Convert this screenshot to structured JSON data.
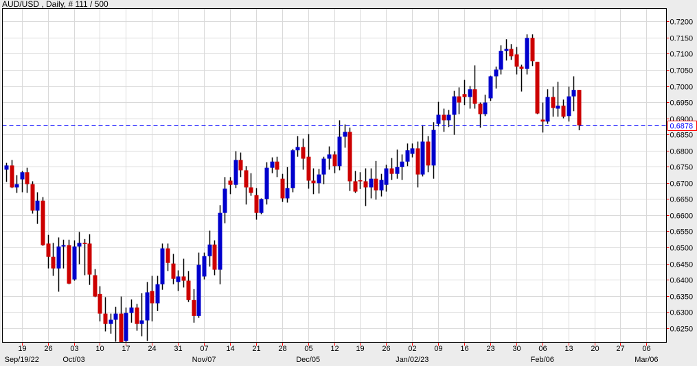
{
  "header": {
    "title": "AUD/USD , Daily, # 111 / 500"
  },
  "chart_data": {
    "type": "candlestick",
    "symbol": "AUD/USD",
    "timeframe": "Daily",
    "bars_shown": 111,
    "bars_total": 500,
    "start_date": "2022-09-14",
    "ylim": [
      0.6206,
      0.724
    ],
    "y_ticks": [
      0.625,
      0.63,
      0.635,
      0.64,
      0.645,
      0.65,
      0.655,
      0.66,
      0.665,
      0.67,
      0.675,
      0.68,
      0.685,
      0.69,
      0.695,
      0.7,
      0.705,
      0.71,
      0.715,
      0.72
    ],
    "current_price": 0.6878,
    "current_price_label": "0.6878",
    "colors": {
      "up": "#0000cc",
      "down": "#cc0000",
      "wick": "#000000",
      "price_line": "#0000ff",
      "grid": "#d9d9d9",
      "tick": "#ff0000"
    },
    "week_ticks": [
      {
        "label": "19",
        "date": "2022-09-19"
      },
      {
        "label": "26",
        "date": "2022-09-26"
      },
      {
        "label": "03",
        "date": "2022-10-03"
      },
      {
        "label": "10",
        "date": "2022-10-10"
      },
      {
        "label": "17",
        "date": "2022-10-17"
      },
      {
        "label": "24",
        "date": "2022-10-24"
      },
      {
        "label": "31",
        "date": "2022-10-31"
      },
      {
        "label": "07",
        "date": "2022-11-07"
      },
      {
        "label": "14",
        "date": "2022-11-14"
      },
      {
        "label": "21",
        "date": "2022-11-21"
      },
      {
        "label": "28",
        "date": "2022-11-28"
      },
      {
        "label": "05",
        "date": "2022-12-05"
      },
      {
        "label": "12",
        "date": "2022-12-12"
      },
      {
        "label": "19",
        "date": "2022-12-19"
      },
      {
        "label": "26",
        "date": "2022-12-26"
      },
      {
        "label": "02",
        "date": "2023-01-02"
      },
      {
        "label": "09",
        "date": "2023-01-09"
      },
      {
        "label": "16",
        "date": "2023-01-16"
      },
      {
        "label": "23",
        "date": "2023-01-23"
      },
      {
        "label": "30",
        "date": "2023-01-30"
      },
      {
        "label": "06",
        "date": "2023-02-06"
      },
      {
        "label": "13",
        "date": "2023-02-13"
      },
      {
        "label": "20",
        "date": "2023-02-20"
      },
      {
        "label": "27",
        "date": "2023-02-27"
      },
      {
        "label": "06",
        "date": "2023-03-06"
      }
    ],
    "month_labels": [
      {
        "label": "Sep/19/22",
        "date": "2022-09-19"
      },
      {
        "label": "Oct/03",
        "date": "2022-10-03"
      },
      {
        "label": "Nov/07",
        "date": "2022-11-07"
      },
      {
        "label": "Dec/05",
        "date": "2022-12-05"
      },
      {
        "label": "Jan/02/23",
        "date": "2023-01-02"
      },
      {
        "label": "Feb/06",
        "date": "2023-02-06"
      },
      {
        "label": "Mar/06",
        "date": "2023-03-06"
      }
    ],
    "ohlc_fields": [
      "open",
      "high",
      "low",
      "close"
    ],
    "candles": [
      [
        0.6741,
        0.6762,
        0.6703,
        0.6754
      ],
      [
        0.6754,
        0.6771,
        0.6684,
        0.6686
      ],
      [
        0.6686,
        0.6724,
        0.6669,
        0.6696
      ],
      [
        0.6711,
        0.6737,
        0.6671,
        0.6733
      ],
      [
        0.6733,
        0.6747,
        0.6669,
        0.6696
      ],
      [
        0.6696,
        0.6705,
        0.6605,
        0.6614
      ],
      [
        0.6614,
        0.6671,
        0.6573,
        0.6645
      ],
      [
        0.6645,
        0.6656,
        0.6505,
        0.6507
      ],
      [
        0.6512,
        0.6539,
        0.6435,
        0.6471
      ],
      [
        0.6471,
        0.6514,
        0.6412,
        0.6435
      ],
      [
        0.6435,
        0.6531,
        0.6363,
        0.6503
      ],
      [
        0.6503,
        0.6524,
        0.6435,
        0.6507
      ],
      [
        0.6507,
        0.6524,
        0.6386,
        0.6388
      ],
      [
        0.6401,
        0.6522,
        0.6397,
        0.6503
      ],
      [
        0.6503,
        0.6548,
        0.6448,
        0.6514
      ],
      [
        0.6514,
        0.6526,
        0.6414,
        0.6513
      ],
      [
        0.6512,
        0.6541,
        0.6384,
        0.6416
      ],
      [
        0.6414,
        0.6433,
        0.6346,
        0.6348
      ],
      [
        0.6356,
        0.638,
        0.6271,
        0.6295
      ],
      [
        0.6295,
        0.6346,
        0.624,
        0.6263
      ],
      [
        0.6263,
        0.6295,
        0.6233,
        0.6276
      ],
      [
        0.6276,
        0.6316,
        0.6208,
        0.6295
      ],
      [
        0.6295,
        0.6348,
        0.62,
        0.6205
      ],
      [
        0.621,
        0.6314,
        0.62,
        0.6297
      ],
      [
        0.6297,
        0.6339,
        0.6267,
        0.6314
      ],
      [
        0.6314,
        0.6325,
        0.6242,
        0.6263
      ],
      [
        0.6263,
        0.6358,
        0.6225,
        0.6274
      ],
      [
        0.6274,
        0.6393,
        0.621,
        0.6361
      ],
      [
        0.6365,
        0.6412,
        0.6271,
        0.6327
      ],
      [
        0.6327,
        0.6412,
        0.6303,
        0.6386
      ],
      [
        0.6386,
        0.6512,
        0.6369,
        0.6497
      ],
      [
        0.6497,
        0.6512,
        0.6427,
        0.6452
      ],
      [
        0.645,
        0.648,
        0.6386,
        0.6403
      ],
      [
        0.6393,
        0.6429,
        0.6365,
        0.641
      ],
      [
        0.641,
        0.6465,
        0.6376,
        0.6397
      ],
      [
        0.6397,
        0.6427,
        0.6331,
        0.6337
      ],
      [
        0.6337,
        0.6371,
        0.6267,
        0.6288
      ],
      [
        0.6288,
        0.6484,
        0.6282,
        0.6446
      ],
      [
        0.641,
        0.6484,
        0.6401,
        0.6473
      ],
      [
        0.6473,
        0.6552,
        0.6441,
        0.6509
      ],
      [
        0.6509,
        0.6522,
        0.6414,
        0.6431
      ],
      [
        0.6431,
        0.6631,
        0.6386,
        0.6607
      ],
      [
        0.6607,
        0.6718,
        0.6575,
        0.6682
      ],
      [
        0.6707,
        0.6718,
        0.6665,
        0.6694
      ],
      [
        0.6694,
        0.6798,
        0.6684,
        0.6771
      ],
      [
        0.6771,
        0.6794,
        0.6718,
        0.6739
      ],
      [
        0.6739,
        0.6752,
        0.6633,
        0.6686
      ],
      [
        0.6686,
        0.673,
        0.666,
        0.6669
      ],
      [
        0.6662,
        0.6684,
        0.6586,
        0.6607
      ],
      [
        0.6607,
        0.6652,
        0.6603,
        0.665
      ],
      [
        0.665,
        0.6764,
        0.6633,
        0.6747
      ],
      [
        0.6747,
        0.6779,
        0.673,
        0.6766
      ],
      [
        0.6766,
        0.6781,
        0.6718,
        0.6741
      ],
      [
        0.6713,
        0.6728,
        0.6641,
        0.6652
      ],
      [
        0.6652,
        0.6749,
        0.6639,
        0.6684
      ],
      [
        0.6684,
        0.6805,
        0.6671,
        0.6801
      ],
      [
        0.6801,
        0.6845,
        0.6781,
        0.6811
      ],
      [
        0.6811,
        0.6837,
        0.6741,
        0.6775
      ],
      [
        0.6781,
        0.6851,
        0.6682,
        0.6707
      ],
      [
        0.6707,
        0.6745,
        0.6665,
        0.6699
      ],
      [
        0.6699,
        0.6743,
        0.6667,
        0.6726
      ],
      [
        0.6726,
        0.6781,
        0.6696,
        0.6775
      ],
      [
        0.6775,
        0.6813,
        0.6741,
        0.6788
      ],
      [
        0.6788,
        0.6798,
        0.673,
        0.6752
      ],
      [
        0.6752,
        0.6894,
        0.6739,
        0.6843
      ],
      [
        0.6843,
        0.6881,
        0.6809,
        0.6858
      ],
      [
        0.6858,
        0.6871,
        0.6675,
        0.6705
      ],
      [
        0.6705,
        0.6737,
        0.6669,
        0.6673
      ],
      [
        0.6708,
        0.6733,
        0.6681,
        0.6707
      ],
      [
        0.6705,
        0.6745,
        0.6628,
        0.6686
      ],
      [
        0.6686,
        0.6745,
        0.6652,
        0.6713
      ],
      [
        0.6713,
        0.6768,
        0.6648,
        0.6677
      ],
      [
        0.6677,
        0.6728,
        0.6658,
        0.6709
      ],
      [
        0.6694,
        0.6756,
        0.6673,
        0.6745
      ],
      [
        0.6745,
        0.6777,
        0.6709,
        0.6728
      ],
      [
        0.6728,
        0.6803,
        0.6713,
        0.6749
      ],
      [
        0.6749,
        0.6788,
        0.6709,
        0.6766
      ],
      [
        0.6766,
        0.6822,
        0.6752,
        0.6801
      ],
      [
        0.679,
        0.6822,
        0.6779,
        0.6807
      ],
      [
        0.6807,
        0.6828,
        0.6686,
        0.6726
      ],
      [
        0.6726,
        0.6879,
        0.672,
        0.6828
      ],
      [
        0.6828,
        0.6845,
        0.6733,
        0.6754
      ],
      [
        0.6754,
        0.6888,
        0.6713,
        0.6864
      ],
      [
        0.6883,
        0.6951,
        0.6875,
        0.6911
      ],
      [
        0.6911,
        0.693,
        0.6858,
        0.6894
      ],
      [
        0.6894,
        0.6926,
        0.6873,
        0.6911
      ],
      [
        0.6911,
        0.6985,
        0.6849,
        0.6968
      ],
      [
        0.6968,
        0.6996,
        0.6913,
        0.6949
      ],
      [
        0.6975,
        0.7019,
        0.6941,
        0.6966
      ],
      [
        0.6966,
        0.7,
        0.693,
        0.699
      ],
      [
        0.699,
        0.7064,
        0.693,
        0.6945
      ],
      [
        0.6945,
        0.6949,
        0.6871,
        0.6913
      ],
      [
        0.6913,
        0.6973,
        0.6907,
        0.6949
      ],
      [
        0.6962,
        0.7032,
        0.6954,
        0.703
      ],
      [
        0.703,
        0.706,
        0.6992,
        0.7051
      ],
      [
        0.7051,
        0.7126,
        0.7036,
        0.7109
      ],
      [
        0.7109,
        0.7145,
        0.7079,
        0.7115
      ],
      [
        0.7115,
        0.713,
        0.7081,
        0.7092
      ],
      [
        0.7098,
        0.7121,
        0.7036,
        0.706
      ],
      [
        0.706,
        0.7066,
        0.6983,
        0.7053
      ],
      [
        0.7053,
        0.716,
        0.7036,
        0.7149
      ],
      [
        0.7149,
        0.716,
        0.7062,
        0.7077
      ],
      [
        0.7075,
        0.7075,
        0.6913,
        0.6915
      ],
      [
        0.6896,
        0.6949,
        0.6856,
        0.689
      ],
      [
        0.689,
        0.699,
        0.6883,
        0.6966
      ],
      [
        0.6966,
        0.6998,
        0.6905,
        0.6932
      ],
      [
        0.693,
        0.7013,
        0.6905,
        0.6939
      ],
      [
        0.6939,
        0.6958,
        0.69,
        0.6905
      ],
      [
        0.6907,
        0.6998,
        0.689,
        0.6968
      ],
      [
        0.6968,
        0.703,
        0.6922,
        0.6988
      ],
      [
        0.6988,
        0.6988,
        0.6863,
        0.6878
      ]
    ]
  }
}
